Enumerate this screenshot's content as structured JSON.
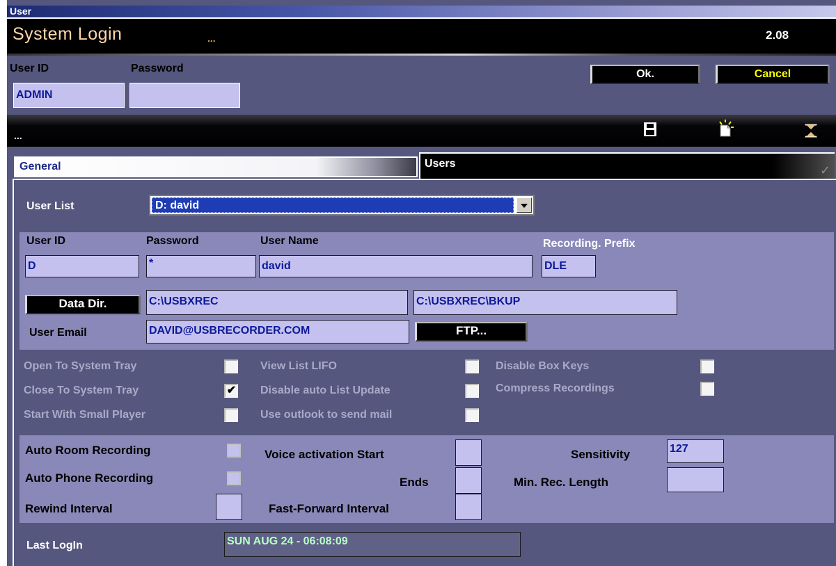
{
  "window": {
    "title": "User"
  },
  "header": {
    "app_title": "System Login",
    "dots": "...",
    "version": "2.08"
  },
  "login": {
    "user_id_label": "User ID",
    "password_label": "Password",
    "user_id_value": "ADMIN",
    "password_value": "",
    "ok_label": "Ok.",
    "cancel_label": "Cancel"
  },
  "toolbar": {
    "status_text": "...",
    "icons": [
      "save-icon",
      "new-icon",
      "delete-icon"
    ]
  },
  "tabs": [
    {
      "label": "General",
      "active": true
    },
    {
      "label": "Users",
      "active": false
    }
  ],
  "users": {
    "user_list_label": "User List",
    "user_list_selected": "D: david",
    "user_id_label": "User ID",
    "password_label": "Password",
    "user_name_label": "User Name",
    "recording_prefix_label": "Recording. Prefix",
    "user_id_value": "D",
    "password_value": "*",
    "user_name_value": "david",
    "recording_prefix_value": "DLE",
    "data_dir_label": "Data Dir.",
    "data_dir_value": "C:\\USBXREC",
    "backup_dir_value": "C:\\USBXREC\\BKUP",
    "user_email_label": "User Email",
    "user_email_value": "DAVID@USBRECORDER.COM",
    "ftp_label": "FTP..."
  },
  "options": {
    "open_to_tray": {
      "label": "Open To System Tray",
      "checked": false
    },
    "close_to_tray": {
      "label": "Close To System Tray",
      "checked": true
    },
    "start_small_player": {
      "label": "Start With Small Player",
      "checked": false
    },
    "view_list_lifo": {
      "label": "View List LIFO",
      "checked": false
    },
    "disable_auto_list_update": {
      "label": "Disable auto List Update",
      "checked": false
    },
    "use_outlook": {
      "label": "Use outlook to send mail",
      "checked": false
    },
    "disable_box_keys": {
      "label": "Disable Box Keys",
      "checked": false
    },
    "compress_recordings": {
      "label": "Compress Recordings",
      "checked": false
    }
  },
  "recording": {
    "auto_room_label": "Auto  Room  Recording",
    "auto_phone_label": "Auto Phone Recording",
    "rewind_label": "Rewind Interval",
    "rewind_value": "",
    "voice_start_label": "Voice activation Start",
    "voice_start_value": "",
    "ends_label": "Ends",
    "ends_value": "",
    "fast_forward_label": "Fast-Forward Interval",
    "fast_forward_value": "",
    "sensitivity_label": "Sensitivity",
    "sensitivity_value": "127",
    "min_rec_length_label": "Min. Rec. Length",
    "min_rec_length_value": ""
  },
  "last_login": {
    "label": "Last LogIn",
    "value": "SUN AUG 24 - 06:08:09"
  },
  "colors": {
    "window_bg": "#55577e",
    "panel_bg": "#8a88b8",
    "field_bg": "#c5c1ee",
    "field_text": "#0c1a9a",
    "title_text": "#ffd7a8",
    "cancel_text": "#ffff00"
  }
}
